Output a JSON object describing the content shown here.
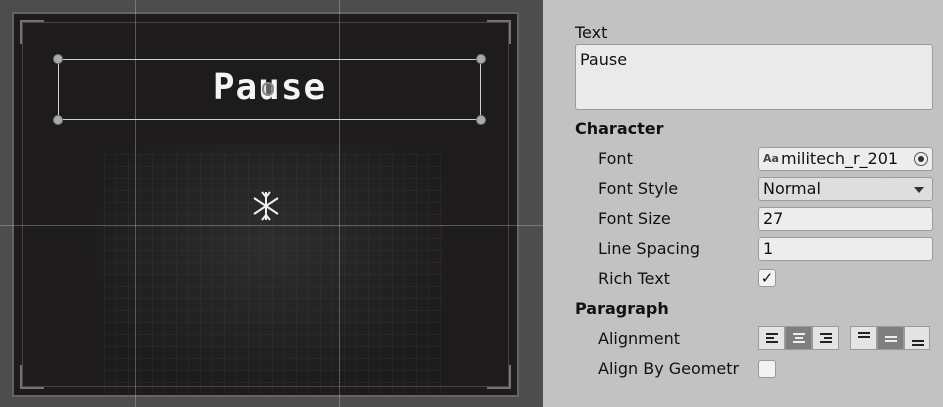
{
  "scene": {
    "label_text": "Pause"
  },
  "inspector": {
    "text_label": "Text",
    "text_value": "Pause",
    "character_header": "Character",
    "font_label": "Font",
    "font_value": "militech_r_201",
    "font_icon_text": "Aa",
    "font_style_label": "Font Style",
    "font_style_value": "Normal",
    "font_size_label": "Font Size",
    "font_size_value": "27",
    "line_spacing_label": "Line Spacing",
    "line_spacing_value": "1",
    "rich_text_label": "Rich Text",
    "rich_text_checked": true,
    "rich_text_check": "✓",
    "paragraph_header": "Paragraph",
    "alignment_label": "Alignment",
    "horizontal_alignment": "center",
    "vertical_alignment": "middle",
    "align_by_geometry_label": "Align By Geometr",
    "align_by_geometry_checked": false
  }
}
